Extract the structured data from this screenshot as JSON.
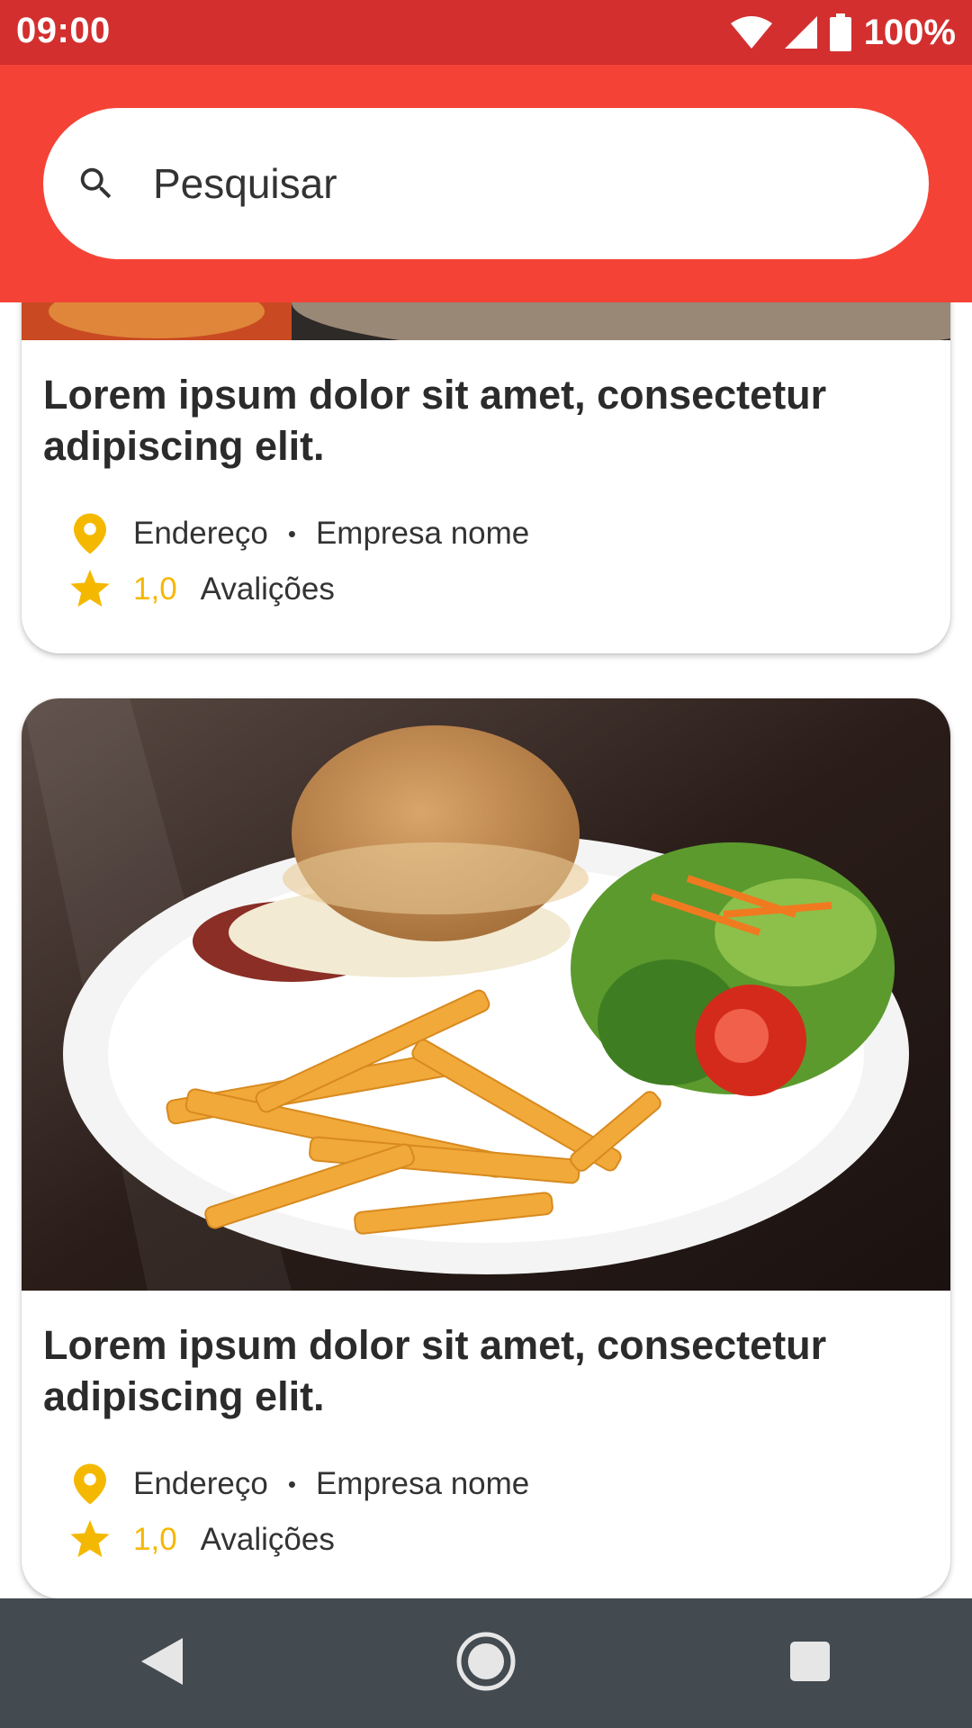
{
  "status_bar": {
    "time": "09:00",
    "battery": "100%"
  },
  "search": {
    "placeholder": "Pesquisar",
    "icon": "search-icon"
  },
  "cards": [
    {
      "title": "Lorem ipsum dolor sit amet, consectetur adipiscing elit.",
      "address": "Endereço",
      "separator": "•",
      "company": "Empresa nome",
      "rating": "1,0",
      "reviews_label": "Avalições"
    },
    {
      "title": "Lorem ipsum dolor sit amet, consectetur adipiscing elit.",
      "address": "Endereço",
      "separator": "•",
      "company": "Empresa nome",
      "rating": "1,0",
      "reviews_label": "Avalições",
      "image": "burger-fries-salad-photo"
    }
  ],
  "colors": {
    "status_bar": "#d32f2f",
    "app_bar": "#f44336",
    "accent_yellow": "#f5b800",
    "nav_bar": "#434a50"
  },
  "nav": {
    "back": "back-icon",
    "home": "home-icon",
    "recents": "recents-icon"
  }
}
